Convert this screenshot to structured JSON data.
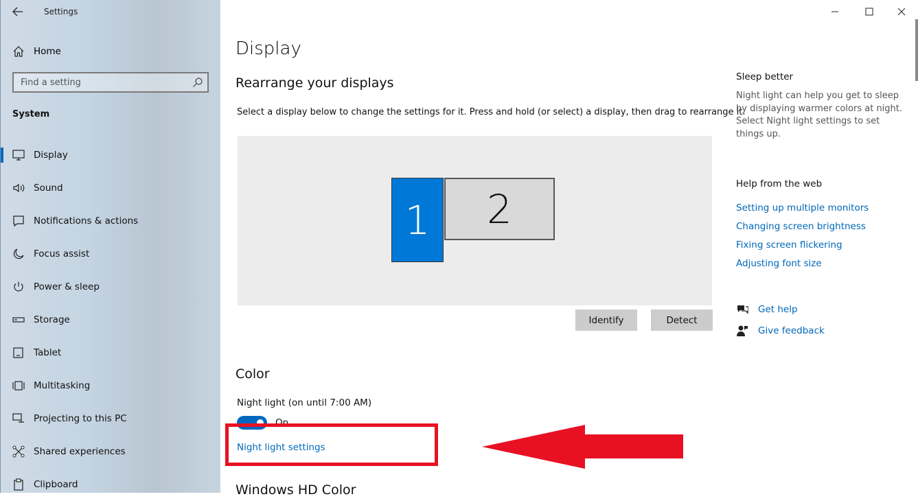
{
  "window": {
    "title": "Settings"
  },
  "sidebar": {
    "home_label": "Home",
    "search_placeholder": "Find a setting",
    "section_title": "System",
    "items": [
      {
        "label": "Display",
        "icon": "monitor-icon",
        "active": true
      },
      {
        "label": "Sound",
        "icon": "speaker-icon"
      },
      {
        "label": "Notifications & actions",
        "icon": "notification-icon"
      },
      {
        "label": "Focus assist",
        "icon": "moon-icon"
      },
      {
        "label": "Power & sleep",
        "icon": "power-icon"
      },
      {
        "label": "Storage",
        "icon": "storage-icon"
      },
      {
        "label": "Tablet",
        "icon": "tablet-icon"
      },
      {
        "label": "Multitasking",
        "icon": "multitasking-icon"
      },
      {
        "label": "Projecting to this PC",
        "icon": "projecting-icon"
      },
      {
        "label": "Shared experiences",
        "icon": "shared-icon"
      },
      {
        "label": "Clipboard",
        "icon": "clipboard-icon"
      }
    ]
  },
  "main": {
    "title": "Display",
    "rearrange_heading": "Rearrange your displays",
    "rearrange_desc": "Select a display below to change the settings for it. Press and hold (or select) a display, then drag to rearrange it.",
    "monitors": [
      "1",
      "2"
    ],
    "identify_label": "Identify",
    "detect_label": "Detect",
    "color_heading": "Color",
    "night_light_label": "Night light (on until 7:00 AM)",
    "toggle_state": "On",
    "night_light_link": "Night light settings",
    "hdr_heading": "Windows HD Color"
  },
  "right_panel": {
    "sleep_heading": "Sleep better",
    "sleep_text": "Night light can help you get to sleep by displaying warmer colors at night. Select Night light settings to set things up.",
    "help_heading": "Help from the web",
    "help_links": [
      "Setting up multiple monitors",
      "Changing screen brightness",
      "Fixing screen flickering",
      "Adjusting font size"
    ],
    "get_help": "Get help",
    "give_feedback": "Give feedback"
  },
  "colors": {
    "accent": "#0078d7",
    "link": "#0067b8",
    "annotation": "#e81123"
  }
}
